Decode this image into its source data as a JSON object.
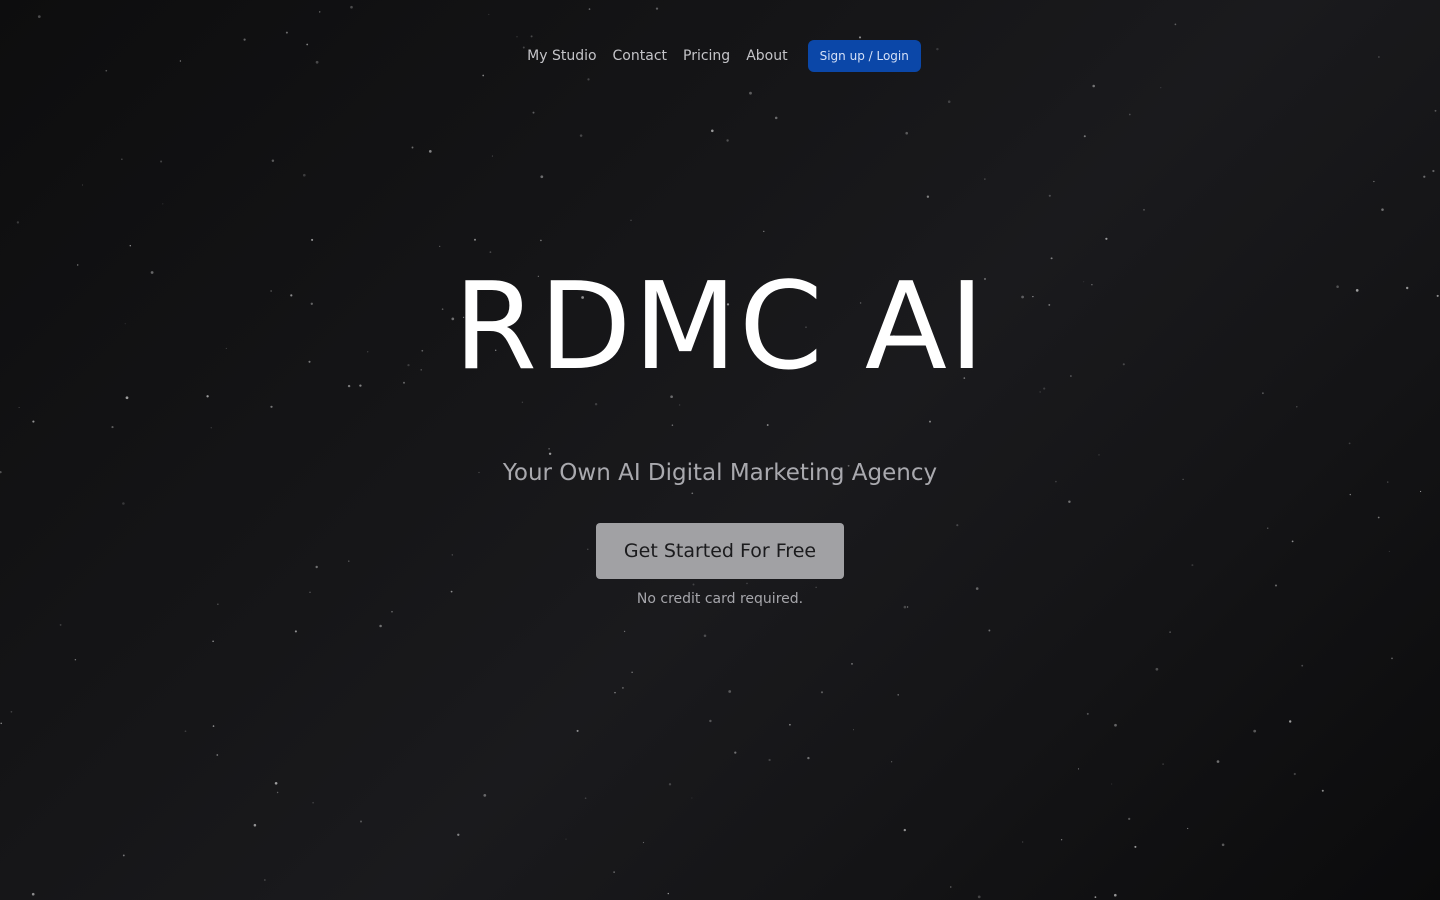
{
  "nav": {
    "links": [
      {
        "label": "My Studio"
      },
      {
        "label": "Contact"
      },
      {
        "label": "Pricing"
      },
      {
        "label": "About"
      }
    ],
    "signup_label": "Sign up / Login"
  },
  "hero": {
    "title": "RDMC AI",
    "subtitle": "Your Own AI Digital Marketing Agency",
    "cta_label": "Get Started For Free",
    "note": "No credit card required."
  },
  "colors": {
    "background": "#151517",
    "signup_button": "#0b47a8",
    "cta_button": "#a1a1a4",
    "title_text": "#ffffff"
  }
}
